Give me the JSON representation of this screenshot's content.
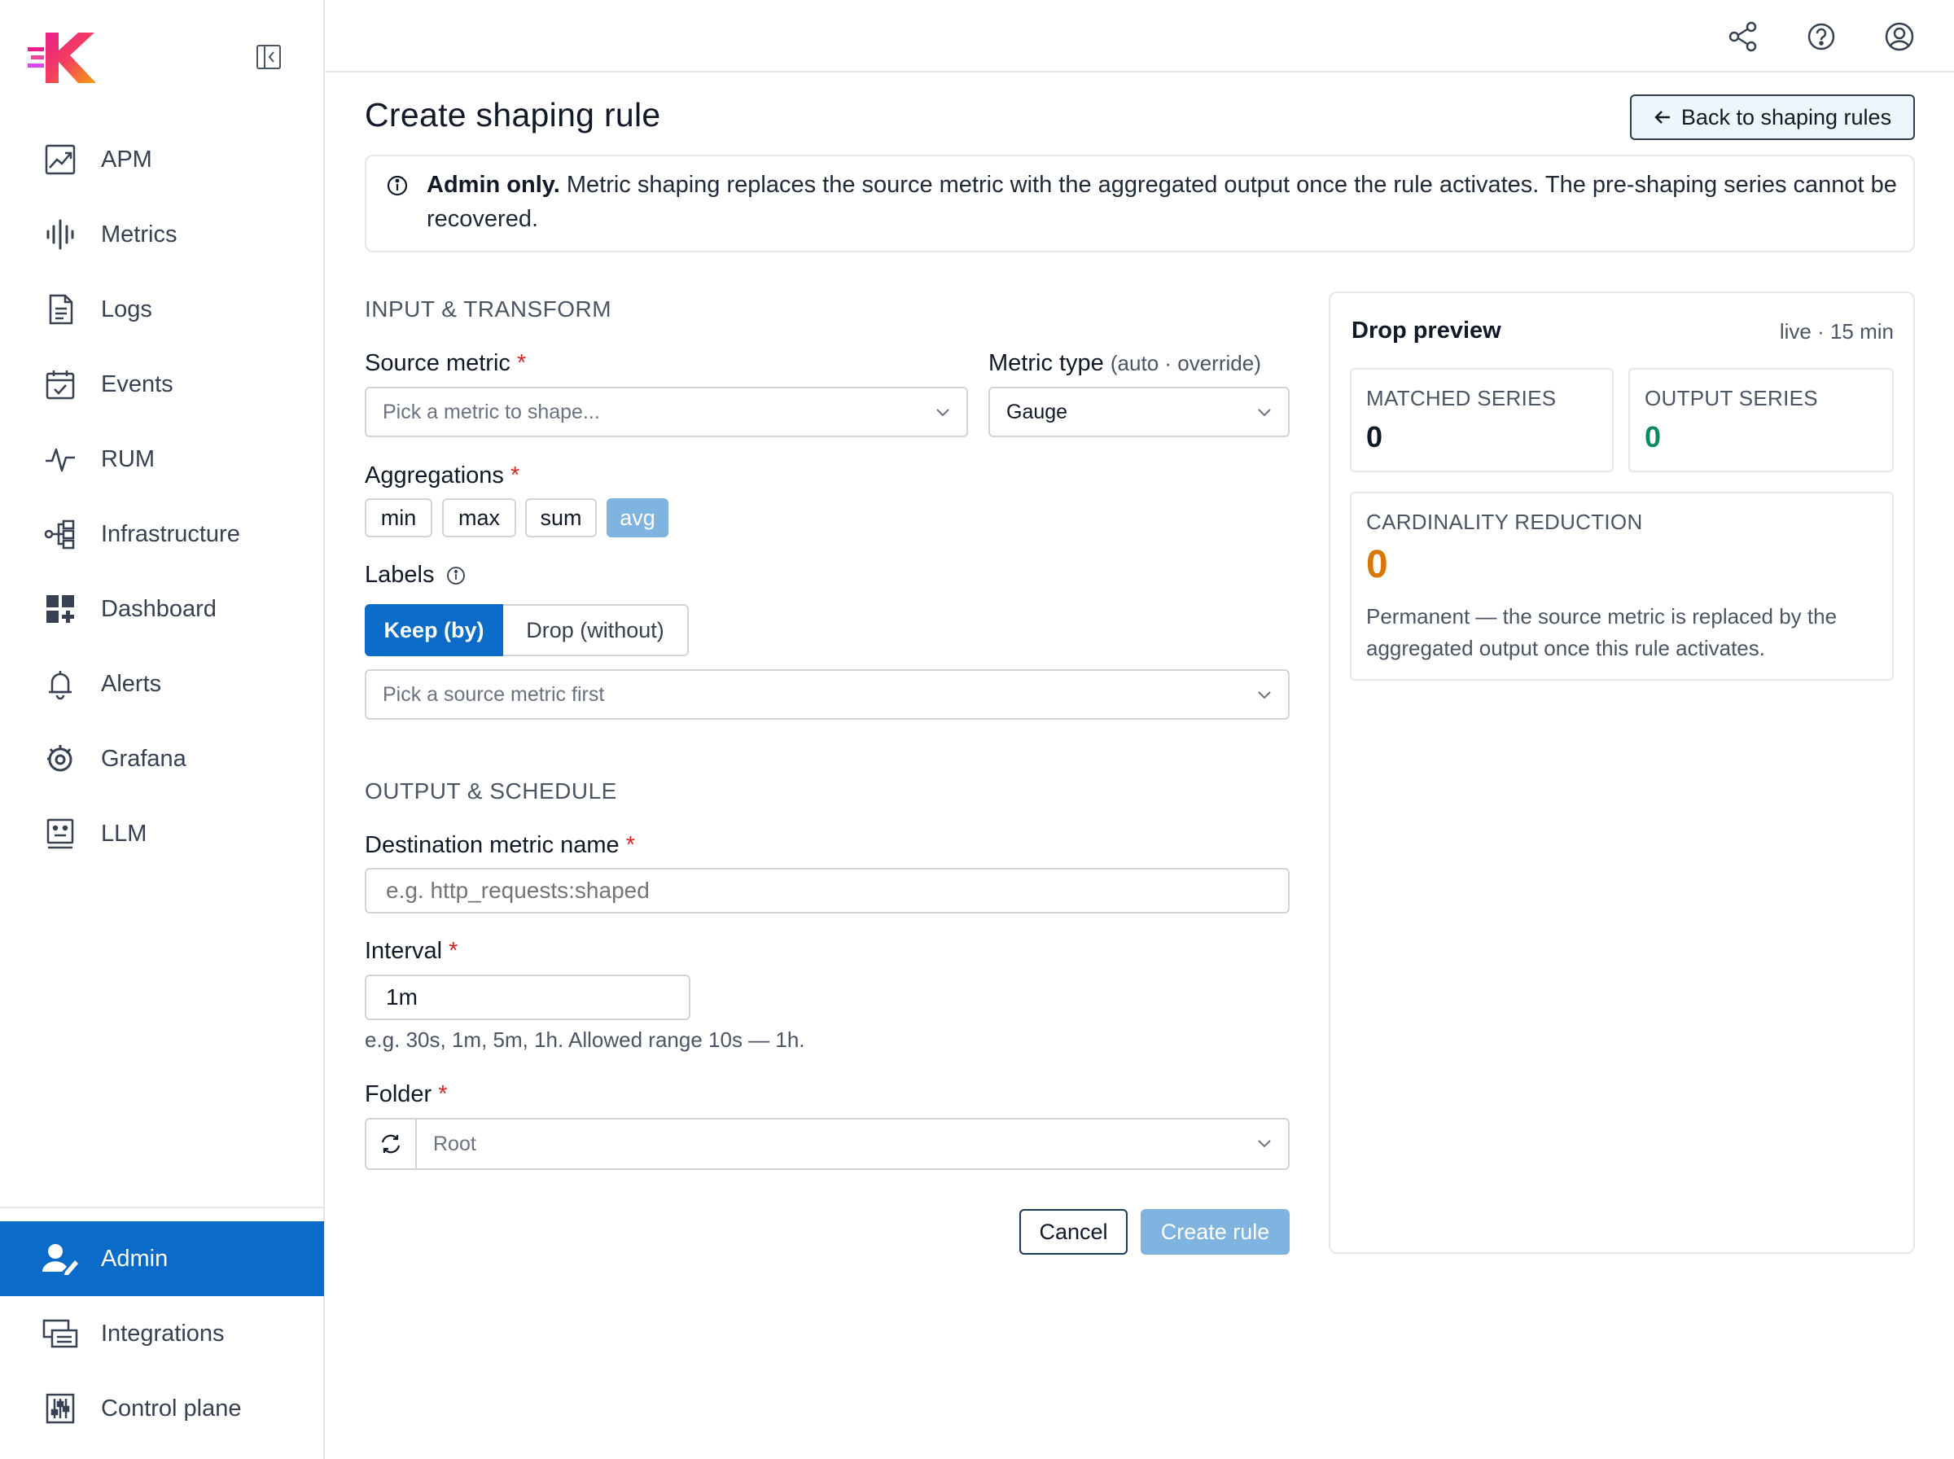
{
  "sidebar": {
    "logo_icon": "k-logo-icon",
    "collapse_icon": "sidebar-collapse-icon",
    "items": [
      {
        "label": "APM",
        "icon": "apm-chart-icon"
      },
      {
        "label": "Metrics",
        "icon": "waveform-icon"
      },
      {
        "label": "Logs",
        "icon": "document-icon"
      },
      {
        "label": "Events",
        "icon": "calendar-check-icon"
      },
      {
        "label": "RUM",
        "icon": "pulse-icon"
      },
      {
        "label": "Infrastructure",
        "icon": "topology-icon"
      },
      {
        "label": "Dashboard",
        "icon": "dashboard-grid-icon"
      },
      {
        "label": "Alerts",
        "icon": "bell-icon"
      },
      {
        "label": "Grafana",
        "icon": "grafana-icon"
      },
      {
        "label": "LLM",
        "icon": "llm-robot-icon"
      }
    ],
    "bottom_items": [
      {
        "label": "Admin",
        "icon": "user-edit-icon",
        "active": true
      },
      {
        "label": "Integrations",
        "icon": "integrations-icon"
      },
      {
        "label": "Control plane",
        "icon": "sliders-icon"
      }
    ]
  },
  "topbar": {
    "icons": [
      "share-icon",
      "help-icon",
      "user-account-icon"
    ]
  },
  "page": {
    "title": "Create shaping rule",
    "back_button": "Back to shaping rules"
  },
  "notice": {
    "bold": "Admin only.",
    "text": " Metric shaping replaces the source metric with the aggregated output once the rule activates. The pre-shaping series cannot be recovered."
  },
  "input_section": {
    "heading": "INPUT & TRANSFORM",
    "source_metric_label": "Source metric",
    "source_metric_placeholder": "Pick a metric to shape...",
    "metric_type_label": "Metric type",
    "metric_type_hint": "(auto · override)",
    "metric_type_value": "Gauge",
    "aggregations_label": "Aggregations",
    "aggregations": [
      {
        "label": "min",
        "selected": false
      },
      {
        "label": "max",
        "selected": false
      },
      {
        "label": "sum",
        "selected": false
      },
      {
        "label": "avg",
        "selected": true
      }
    ],
    "labels_label": "Labels",
    "keep_label": "Keep (by)",
    "drop_label": "Drop (without)",
    "labels_placeholder": "Pick a source metric first",
    "required_mark": "*"
  },
  "output_section": {
    "heading": "OUTPUT & SCHEDULE",
    "dest_label": "Destination metric name",
    "dest_placeholder": "e.g. http_requests:shaped",
    "interval_label": "Interval",
    "interval_value": "1m",
    "interval_hint": "e.g. 30s, 1m, 5m, 1h. Allowed range 10s — 1h.",
    "folder_label": "Folder",
    "folder_value": "Root"
  },
  "actions": {
    "cancel": "Cancel",
    "create": "Create rule"
  },
  "preview": {
    "title": "Drop preview",
    "live": "live · 15 min",
    "matched_label": "MATCHED SERIES",
    "matched_value": "0",
    "output_label": "OUTPUT SERIES",
    "output_value": "0",
    "cardinality_label": "CARDINALITY REDUCTION",
    "cardinality_value": "0",
    "cardinality_desc": "Permanent — the source metric is replaced by the aggregated output once this rule activates.",
    "colors": {
      "output": "#0f8a5f",
      "cardinality": "#d97706",
      "accent": "#0b6bc9"
    }
  }
}
